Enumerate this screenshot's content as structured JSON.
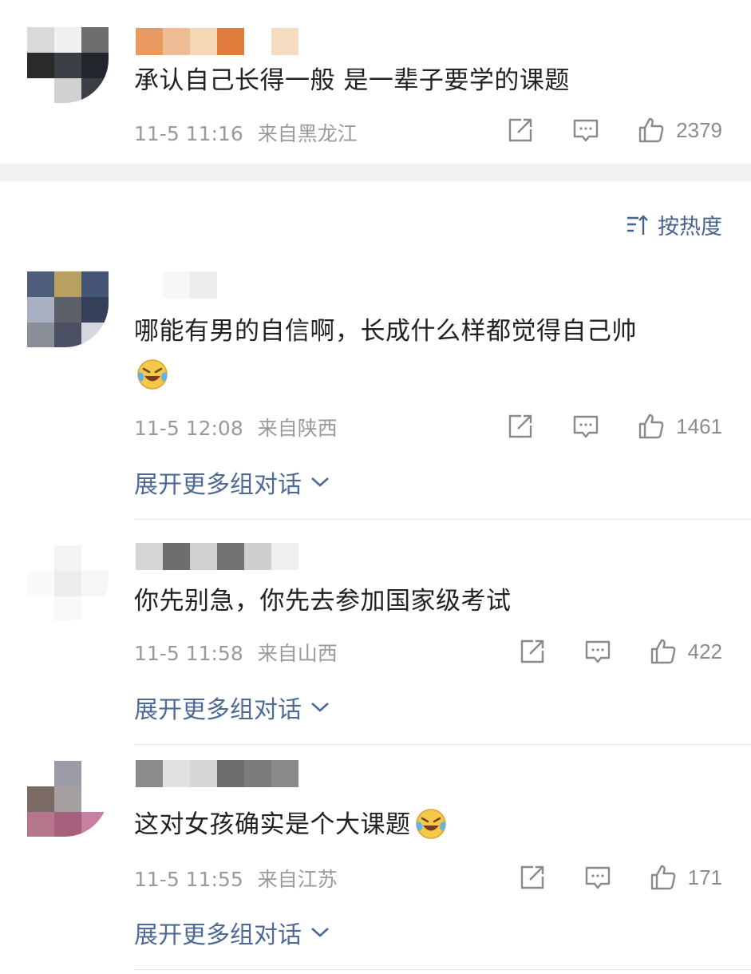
{
  "top_post": {
    "text": "承认自己长得一般 是一辈子要学的课题",
    "time": "11-5 11:16",
    "location": "来自黑龙江",
    "likes": "2379",
    "avatar_colors": [
      "#d9d9d9",
      "#f0f0f0",
      "#6e6e6e",
      "#2a2a2a",
      "#3a3f46",
      "#22262c",
      "#ffffff",
      "#d0d0d0",
      "#3b3e44"
    ],
    "name_colors": [
      "#e89a5f",
      "#edbb94",
      "#f6d7b3",
      "#e07b3c",
      "#ffffff",
      "#f5dcc0"
    ]
  },
  "sort": {
    "label": "按热度"
  },
  "comments": [
    {
      "text": "哪能有男的自信啊，长成什么样都觉得自己帅",
      "emoji": "laughing-crying-emoji",
      "time": "11-5 12:08",
      "location": "来自陕西",
      "likes": "1461",
      "expand_label": "展开更多组对话",
      "avatar_colors": [
        "#4e5d7a",
        "#b8a061",
        "#445576",
        "#a9b0c2",
        "#5d6068",
        "#34405a",
        "#8a8e99",
        "#4b5063",
        "#d5d8e0"
      ],
      "name_colors": [
        "#ffffff",
        "#f7f7f7",
        "#ececec",
        "#ffffff",
        "#ffffff",
        "#ffffff"
      ]
    },
    {
      "text": "你先别急，你先去参加国家级考试",
      "time": "11-5 11:58",
      "location": "来自山西",
      "likes": "422",
      "expand_label": "展开更多组对话",
      "avatar_colors": [
        "#ffffff",
        "#f3f3f3",
        "#ffffff",
        "#fafafa",
        "#ececec",
        "#f6f6f6",
        "#ffffff",
        "#f8f8f8",
        "#ffffff"
      ],
      "name_colors": [
        "#d6d6d6",
        "#6e6e6e",
        "#d0d0d0",
        "#727272",
        "#cfcfcf",
        "#efefef"
      ]
    },
    {
      "text": "这对女孩确实是个大课题",
      "emoji": "laughing-crying-emoji",
      "time": "11-5 11:55",
      "location": "来自江苏",
      "likes": "171",
      "expand_label": "展开更多组对话",
      "avatar_colors": [
        "#ffffff",
        "#9a9ba6",
        "#ffffff",
        "#7b6a66",
        "#a69f9f",
        "#ffffff",
        "#b7758d",
        "#a6627c",
        "#c980a0"
      ],
      "name_colors": [
        "#8b8b8b",
        "#e2e2e2",
        "#d6d6d6",
        "#6e6e6e",
        "#7c7c7c",
        "#8a8a8a"
      ]
    }
  ],
  "colors": {
    "link_blue": "#4e6a94",
    "meta_gray": "#9a9a9a",
    "divider_band": "#f2f2f2"
  }
}
